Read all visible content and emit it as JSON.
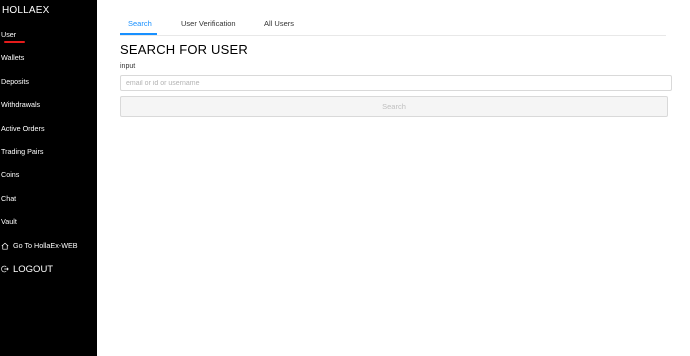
{
  "sidebar": {
    "brand": "HOLLAEX",
    "items": [
      {
        "label": "User",
        "active": true
      },
      {
        "label": "Wallets"
      },
      {
        "label": "Deposits"
      },
      {
        "label": "Withdrawals"
      },
      {
        "label": "Active Orders"
      },
      {
        "label": "Trading Pairs"
      },
      {
        "label": "Coins"
      },
      {
        "label": "Chat"
      },
      {
        "label": "Vault"
      }
    ],
    "goto": {
      "label": "Go To HollaEx-WEB",
      "icon": "home-icon"
    },
    "logout": {
      "label": "LOGOUT",
      "icon": "logout-icon"
    },
    "active_indicator_color": "#e41b1b"
  },
  "tabs": [
    {
      "label": "Search",
      "active": true
    },
    {
      "label": "User Verification"
    },
    {
      "label": "All Users"
    }
  ],
  "main": {
    "title": "SEARCH FOR USER",
    "input_label": "input",
    "input_placeholder": "email or id or username",
    "input_value": "",
    "search_button": "Search"
  },
  "colors": {
    "accent": "#1890ff",
    "sidebar_bg": "#000000"
  }
}
